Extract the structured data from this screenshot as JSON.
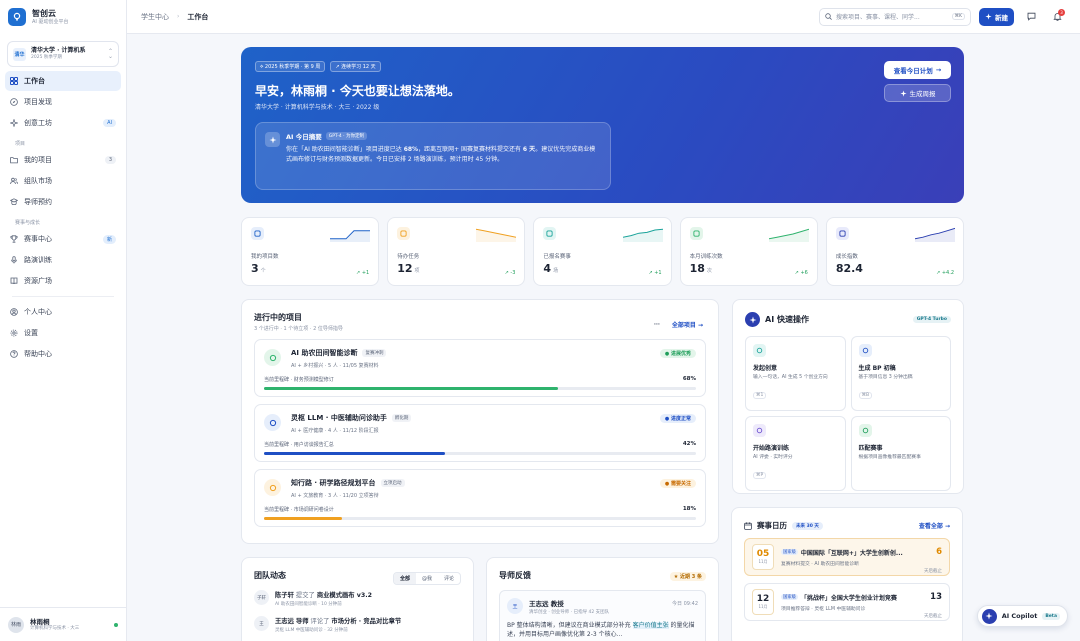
{
  "brand": {
    "name": "智创云",
    "tagline": "AI 驱动创业平台"
  },
  "school": {
    "badge": "清华",
    "name": "清华大学 · 计算机系",
    "term": "2025 秋季学期"
  },
  "nav": {
    "main": [
      {
        "label": "工作台"
      },
      {
        "label": "项目发现"
      },
      {
        "label": "创意工坊",
        "badge": "AI"
      }
    ],
    "section_projects": "项目",
    "projects": [
      {
        "label": "我的项目",
        "count": "3"
      },
      {
        "label": "组队市场"
      },
      {
        "label": "导师预约"
      }
    ],
    "section_growth": "赛事与成长",
    "growth": [
      {
        "label": "赛事中心",
        "badge": "新"
      },
      {
        "label": "路演训练"
      },
      {
        "label": "资源广场"
      }
    ],
    "bottom": [
      {
        "label": "个人中心"
      },
      {
        "label": "设置"
      },
      {
        "label": "帮助中心"
      }
    ]
  },
  "user": {
    "avatar": "林雨",
    "name": "林雨桐",
    "info": "计算机科学与技术 · 大三"
  },
  "topbar": {
    "crumb_root": "学生中心",
    "crumb_current": "工作台",
    "search_placeholder": "搜索项目、赛事、课程、同学...",
    "search_kbd": "⌘K",
    "new_label": "新建",
    "notif_count": "3"
  },
  "hero": {
    "chip1": "2025 秋季学期 · 第 9 周",
    "chip2": "连续学习 12 天",
    "title": "早安，林雨桐 · 今天也要让想法落地。",
    "subtitle": "清华大学 · 计算机科学与技术 · 大三 · 2022 级",
    "ai_title": "AI 今日摘要",
    "ai_tag": "GPT-4 · 为你定制",
    "ai_text_1": "你在「AI 助农田间智能诊断」项目进度已达 ",
    "ai_pct": "68%",
    "ai_text_2": "，距离互联网+ 国赛复赛材料提交还有 ",
    "ai_days": "6 天",
    "ai_text_3": "。建议优先完成商业模式画布修订与财务预测数据更新。今日已安排 2 场路演训练，预计用时 45 分钟。",
    "btn_plan": "查看今日计划",
    "btn_report": "生成周报"
  },
  "stats": [
    {
      "label": "我的项目数",
      "value": "3",
      "unit": "个",
      "delta": "+1",
      "color": "#1f62c8",
      "bg": "#e6eefb",
      "spark": [
        0.2,
        0.2,
        0.2,
        0.7,
        0.7,
        0.7
      ]
    },
    {
      "label": "待办任务",
      "value": "12",
      "unit": "项",
      "delta": "-3",
      "color": "#f0a020",
      "bg": "#fdf2df",
      "spark": [
        0.8,
        0.7,
        0.6,
        0.5,
        0.4,
        0.3
      ]
    },
    {
      "label": "已报名赛事",
      "value": "4",
      "unit": "场",
      "delta": "+1",
      "color": "#1aa39a",
      "bg": "#e2f5f3",
      "spark": [
        0.3,
        0.4,
        0.55,
        0.6,
        0.75,
        0.8
      ]
    },
    {
      "label": "本月训练次数",
      "value": "18",
      "unit": "次",
      "delta": "+6",
      "color": "#2fb36d",
      "bg": "#e3f5ea",
      "spark": [
        0.2,
        0.3,
        0.4,
        0.5,
        0.65,
        0.8
      ]
    },
    {
      "label": "成长指数",
      "value": "82.4",
      "unit": "",
      "delta": "+4.2",
      "color": "#2b3fb0",
      "bg": "#e8eafb",
      "spark": [
        0.2,
        0.3,
        0.45,
        0.55,
        0.7,
        0.85
      ]
    }
  ],
  "projects": {
    "title": "进行中的项目",
    "subtitle": "3 个进行中 · 1 个待立项 · 2 位导师指导",
    "all": "全部项目",
    "items": [
      {
        "name": "AI 助农田间智能诊断",
        "tag": "复赛冲刺",
        "meta": "AI + 乡村振兴",
        "members": "5 人",
        "date": "11/05 复赛材料",
        "status": "进展优秀",
        "status_fg": "#1e9e5a",
        "status_bg": "#e3f5ea",
        "stage": "当前里程碑 · 财务预测模型修订",
        "pct": "68%",
        "progress": 0.68,
        "color": "#2fb36d",
        "icbg": "#e3f5ea"
      },
      {
        "name": "灵枢 LLM · 中医辅助问诊助手",
        "tag": "孵化期",
        "meta": "AI + 医疗健康",
        "members": "4 人",
        "date": "11/12 阶段汇报",
        "status": "进度正常",
        "status_fg": "#1f4fc4",
        "status_bg": "#e6eefb",
        "stage": "当前里程碑 · 用户访谈报告汇总",
        "pct": "42%",
        "progress": 0.42,
        "color": "#1f4fc4",
        "icbg": "#e6eefb"
      },
      {
        "name": "知行路 · 研学路径规划平台",
        "tag": "立项启动",
        "meta": "AI + 文旅教育",
        "members": "3 人",
        "date": "11/20 立项答辩",
        "status": "需要关注",
        "status_fg": "#c76a00",
        "status_bg": "#fdf2df",
        "stage": "当前里程碑 · 市场调研问卷设计",
        "pct": "18%",
        "progress": 0.18,
        "color": "#f0a020",
        "icbg": "#fdf2df"
      }
    ]
  },
  "quick": {
    "title": "AI 快速操作",
    "model": "GPT-4 Turbo",
    "tiles": [
      {
        "title": "发起创意",
        "desc": "输入一句话，AI 生成 5 个创业方向",
        "kbd": "⌘1",
        "color": "#1aa39a",
        "bg": "#e2f5f3"
      },
      {
        "title": "生成 BP 初稿",
        "desc": "基于项目信息 3 分钟出稿",
        "kbd": "⌘B",
        "color": "#1f4fc4",
        "bg": "#e6eefb"
      },
      {
        "title": "开始路演训练",
        "desc": "AI 评委 · 实时评分",
        "kbd": "⌘P",
        "color": "#6b4fd0",
        "bg": "#eeeafb"
      },
      {
        "title": "匹配赛事",
        "desc": "根据项目画像推荐最匹配赛事",
        "kbd": "",
        "color": "#1e9e5a",
        "bg": "#e3f5ea"
      }
    ]
  },
  "calendar": {
    "title": "赛事日历",
    "tag": "未来 30 天",
    "all": "查看全部",
    "events": [
      {
        "day": "05",
        "month": "11月",
        "tag": "国家级",
        "name": "中国国际「互联网+」大学生创新创...",
        "sub": "复赛材料提交 · AI 助农田间智能诊断",
        "days": "6",
        "days_label": "天后截止",
        "days_color": "#e08a00"
      },
      {
        "day": "12",
        "month": "11月",
        "tag": "国家级",
        "name": "「挑战杯」全国大学生创业计划竞赛",
        "sub": "项目推荐答辩 · 灵枢 LLM 中医辅助问诊",
        "days": "13",
        "days_label": "天后截止",
        "days_color": "#1d2433"
      }
    ]
  },
  "team": {
    "title": "团队动态",
    "tabs": [
      "全部",
      "@我",
      "评论"
    ],
    "feed": [
      {
        "avatar": "子轩",
        "name": "陈子轩",
        "action": "提交了",
        "obj": "商业模式画布 v3.2",
        "proj": "AI 助农田间智能诊断",
        "time": "10 分钟前"
      },
      {
        "avatar": "王",
        "name": "王志远",
        "action": "导师",
        "extra": "评论了",
        "obj": "市场分析 · 竞品对比章节",
        "proj": "灵枢 LLM 中医辅助问诊",
        "time": "32 分钟前"
      }
    ]
  },
  "mentor": {
    "title": "导师反馈",
    "tag": "近期 3 条",
    "card": {
      "avatar": "王",
      "name": "王志远 教授",
      "sub": "清华创业 · 创业导师 · 已指导 42 支团队",
      "time": "今日 09:42",
      "body_1": "BP 整体结构清晰，但建议在商业模式部分补充 ",
      "hl": "客户价值主张",
      "body_2": " 的量化描述，并用目标用户画像优化第 2-3 个核心..."
    }
  },
  "copilot": {
    "label": "AI Copilot",
    "beta": "Beta"
  }
}
